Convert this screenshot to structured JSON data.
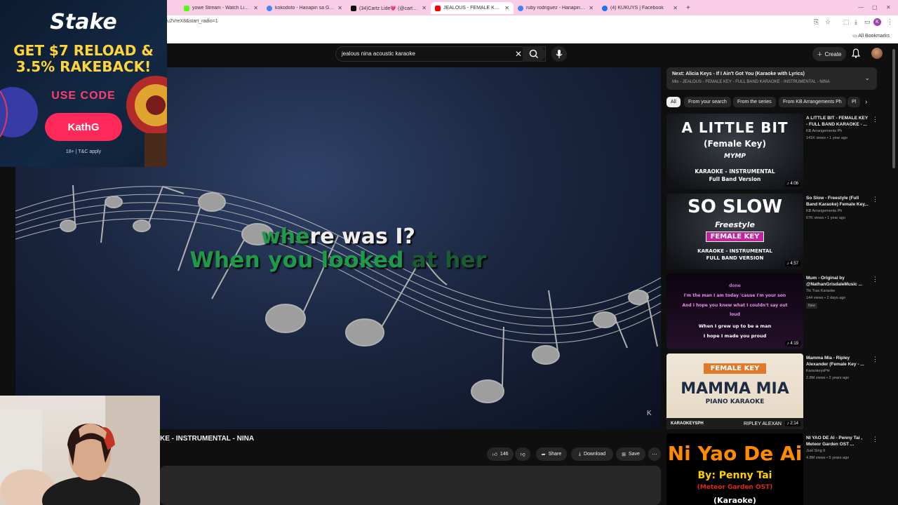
{
  "browser": {
    "tabs": [
      {
        "label": "yowe Stream - Watch Live on K",
        "favicon_color": "#53fc18",
        "active": false
      },
      {
        "label": "kokodoto - Hanapin sa Google",
        "favicon_color": "#4285f4",
        "active": false
      },
      {
        "label": "(34)Cartz Lide💗 (@cartzlee) |",
        "favicon_color": "#111111",
        "active": false
      },
      {
        "label": "JEALOUS - FEMALE KEY - FULL",
        "favicon_color": "#ff0000",
        "active": true
      },
      {
        "label": "ruby rodriguez - Hanapin sa G",
        "favicon_color": "#4285f4",
        "active": false
      },
      {
        "label": "(4) KUKUYS | Facebook",
        "favicon_color": "#1877f2",
        "active": false
      }
    ],
    "new_tab": "+",
    "url": "u2VreX8&start_radio=1",
    "bookmarks_label": "All Bookmarks",
    "profile_initial": "K"
  },
  "youtube": {
    "search_value": "jealous nina acoustic karaoke",
    "create_label": "Create"
  },
  "player": {
    "lyric_line1_sung": "whe",
    "lyric_line1_rest": "re was I?",
    "lyric_line2_sung": "When you looked ",
    "lyric_line2_rest": "at her",
    "logo_mark": "K"
  },
  "video": {
    "title_visible": "KE - INSTRUMENTAL - NINA",
    "like_count": "146",
    "share_label": "Share",
    "download_label": "Download",
    "save_label": "Save"
  },
  "sidebar": {
    "next_title": "Next: Alicia Keys - If I Ain't Got You (Karaoke with Lyrics)",
    "next_sub": "Mix - JEALOUS - FEMALE KEY - FULL BAND KARAOKE - INSTRUMENTAL - NINA",
    "chips": [
      "All",
      "From your search",
      "From the series",
      "From KB Arrangements Ph",
      "Pl"
    ],
    "recommendations": [
      {
        "title": "A LITTLE BIT - FEMALE KEY - FULL BAND KARAOKE - ...",
        "channel": "KB Arrangements Ph",
        "meta": "141K views • 1 year ago",
        "duration": "4:06",
        "thumb": {
          "line1": "A LITTLE BIT",
          "line2": "(Female Key)",
          "line3": "MYMP",
          "line4": "KARAOKE - INSTRUMENTAL",
          "line5": "Full Band Version"
        }
      },
      {
        "title": "So Slow - Freestyle (Full Band Karaoke) Female Key...",
        "channel": "KB Arrangements Ph",
        "meta": "67K views • 1 year ago",
        "duration": "4:57",
        "thumb": {
          "line1": "SO SLOW",
          "line2": "Freestyle",
          "line3": "FEMALE KEY",
          "line4": "KARAOKE - INSTRUMENTAL",
          "line5": "FULL BAND VERSION"
        }
      },
      {
        "title": "Mum - Original by @NathanGrisdaleMusic ...",
        "channel": "Tik Trax Karaoke",
        "meta": "144 views • 2 days ago",
        "badge": "New",
        "duration": "4:19",
        "thumb": {
          "line0": "done",
          "line1": "I'm the man I am today 'cause I'm your son",
          "line2": "And I hope you knew what I couldn't say out",
          "line3": "loud",
          "line4": "When I grew up to be a man",
          "line5": "I hope I made you proud"
        }
      },
      {
        "title": "Mamma Mia - Ripley Alexander (Female Key - ...",
        "channel": "KaraokeysPH",
        "meta": "2.8M views • 2 years ago",
        "duration": "2:14",
        "thumb": {
          "line1": "FEMALE KEY",
          "line2": "MAMMA MIA",
          "line3": "PIANO KARAOKE",
          "line4": "KARAOKEYSPH",
          "line5": "RIPLEY ALEXAN"
        }
      },
      {
        "title": "NI YAO DE AI - Penny Tai , Meteor Garden OST ...",
        "channel": "Just Sing It",
        "meta": "4.8M views • 5 years ago",
        "duration": "4:12",
        "thumb": {
          "line1": "Ni Yao De Ai",
          "line2": "By: Penny Tai",
          "line3": "(Meteor Garden OST)",
          "line4": "(Karaoke)"
        }
      }
    ]
  },
  "ad": {
    "brand": "Stake",
    "line1": "GET $7 RELOAD &",
    "line2": "3.5% RAKEBACK!",
    "code_label": "USE CODE",
    "code": "KathG",
    "terms": "18+ | T&C apply"
  },
  "colors": {
    "tabbar_bg": "#f9cde6",
    "yt_bg": "#0f0f0f",
    "lyric_sung": "#1f9a4a",
    "ad_gold": "#ffd43b",
    "ad_pink": "#ff2a5a"
  }
}
